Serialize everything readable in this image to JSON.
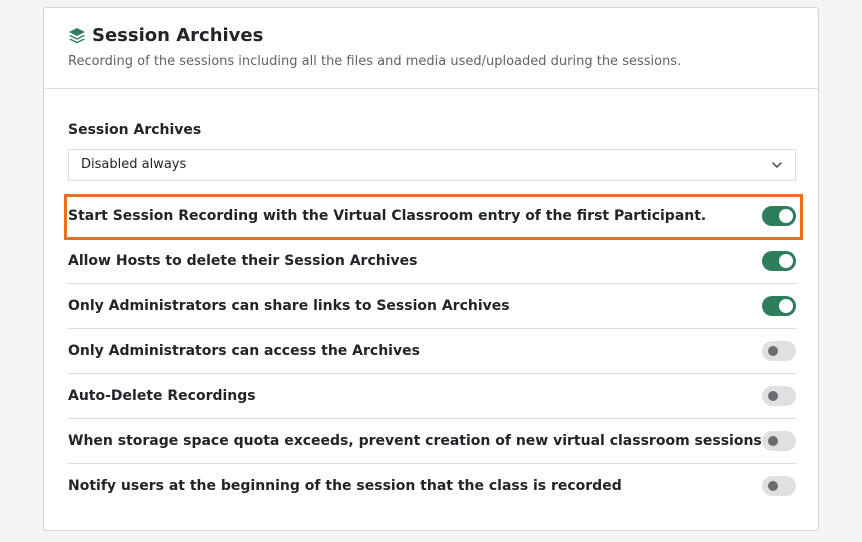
{
  "header": {
    "icon": "layers-icon",
    "title": "Session Archives",
    "subtitle": "Recording of the sessions including all the files and media used/uploaded during the sessions."
  },
  "archive_select": {
    "label": "Session Archives",
    "value": "Disabled always"
  },
  "settings": [
    {
      "label": "Start Session Recording with the Virtual Classroom entry of the first Participant.",
      "enabled": true
    },
    {
      "label": "Allow Hosts to delete their Session Archives",
      "enabled": true
    },
    {
      "label": "Only Administrators can share links to Session Archives",
      "enabled": true
    },
    {
      "label": "Only Administrators can access the Archives",
      "enabled": false
    },
    {
      "label": "Auto-Delete Recordings",
      "enabled": false
    },
    {
      "label": "When storage space quota exceeds, prevent creation of new virtual classroom sessions",
      "enabled": false
    },
    {
      "label": "Notify users at the beginning of the session that the class is recorded",
      "enabled": false
    }
  ],
  "colors": {
    "toggle_on": "#2e7d5b",
    "toggle_off": "#e0e0e3",
    "highlight": "#e8711e"
  }
}
